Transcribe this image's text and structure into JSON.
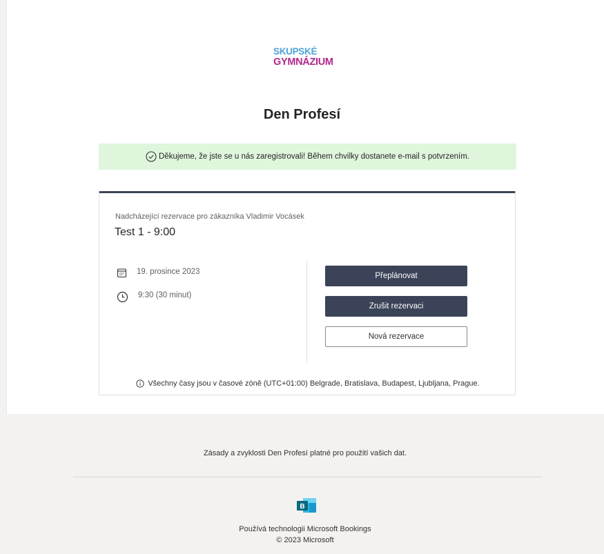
{
  "brand": {
    "logo_line1": "SKUPSKÉ",
    "logo_line2": "GYMNÁZIUM",
    "logo_color_top": "#4ea3d8",
    "logo_color_bottom": "#b0278a"
  },
  "page_title": "Den Profesí",
  "banner": {
    "icon": "check-circle-icon",
    "text": "Děkujeme, že jste se u nás zaregistrovali! Během chvilky dostanete e-mail s potvrzením.",
    "color": "#dff6dd"
  },
  "booking": {
    "subtitle": "Nadcházející rezervace pro zákazníka Vladimir Vocásek",
    "service": "Test 1 - 9:00",
    "date": {
      "icon": "calendar-icon",
      "text": "19. prosince 2023"
    },
    "time": {
      "icon": "clock-icon",
      "text": "9:30 (30 minut)"
    },
    "buttons": {
      "reschedule": "Přeplánovat",
      "cancel": "Zrušit rezervaci",
      "new": "Nová rezervace"
    },
    "accent": "#3b4358",
    "timezone_icon": "info-icon",
    "timezone_note": "Všechny časy jsou v časové zóně (UTC+01:00) Belgrade, Bratislava, Budapest, Ljubljana, Prague."
  },
  "footer": {
    "policy": "Zásady a zvyklosti Den Profesí platné pro použití vašich dat.",
    "logo_icon": "microsoft-bookings-icon",
    "powered_by": "Používá technologii Microsoft Bookings",
    "copyright": "© 2023 Microsoft"
  }
}
